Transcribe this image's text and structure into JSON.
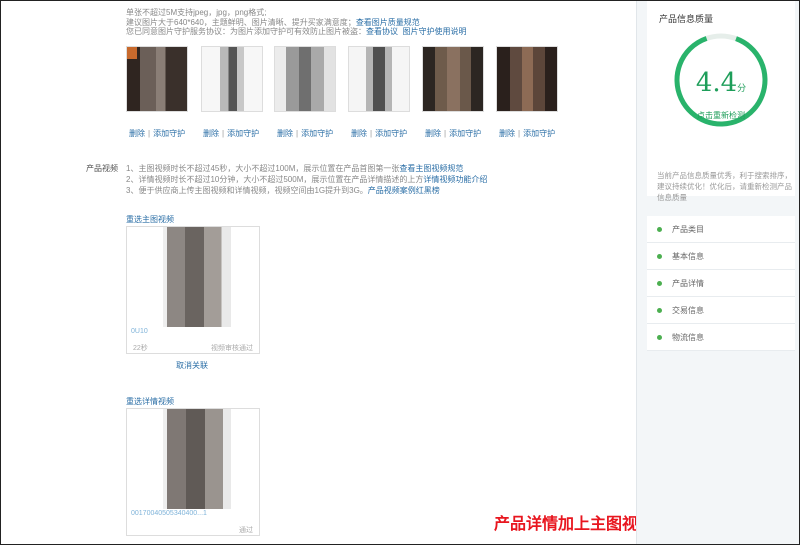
{
  "upload_hints": {
    "line1": "单张不超过5M支持jpeg，jpg，png格式;",
    "line2": "建议图片大于640*640，主题鲜明、图片清晰、提升买家满意度；",
    "line2_link": "查看图片质量规范",
    "line3": "您已同意图片守护服务协议：为图片添加守护可有效防止图片被盗：",
    "line3_link1": "查看协议",
    "line3_link2": "图片守护使用说明"
  },
  "image_actions": {
    "delete": "删除",
    "separator": "|",
    "protect": "添加守护"
  },
  "image_count": 6,
  "video_section": {
    "label": "产品视频",
    "rule1": "1、主图视频时长不超过45秒，大小不超过100M，展示位置在产品首图第一张",
    "rule1_link": "查看主图视频规范",
    "rule2": "2、详情视频时长不超过10分钟，大小不超过500M，展示位置在产品详情描述的上方",
    "rule2_link": "详情视频功能介绍",
    "rule3": "3、便于供应商上传主图视频和详情视频，视频空间由1G提升到3G。",
    "rule3_link": "产品视频案例红黑榜",
    "main_video": {
      "reselect": "重选主图视频",
      "title": "0U10",
      "duration": "22秒",
      "status": "视频审核通过",
      "unlink": "取消关联"
    },
    "detail_video": {
      "reselect": "重选详情视频",
      "title": "00170040505340400...1",
      "status": "通过"
    }
  },
  "overlay_caption": "产品详情加上主图视频和详情视频",
  "sidebar": {
    "title": "产品信息质量",
    "score": "4.4",
    "score_unit": "分",
    "recheck": "点击重新检测",
    "note": "当前产品信息质量优秀，利于搜索排序，建议持续优化！优化后，请重新检测产品信息质量",
    "items": [
      {
        "label": "产品类目"
      },
      {
        "label": "基本信息"
      },
      {
        "label": "产品详情"
      },
      {
        "label": "交易信息"
      },
      {
        "label": "物流信息"
      }
    ]
  },
  "colors": {
    "link": "#2a6ea6",
    "accent_green": "#1e9e5a",
    "overlay_red": "#e8161f"
  }
}
